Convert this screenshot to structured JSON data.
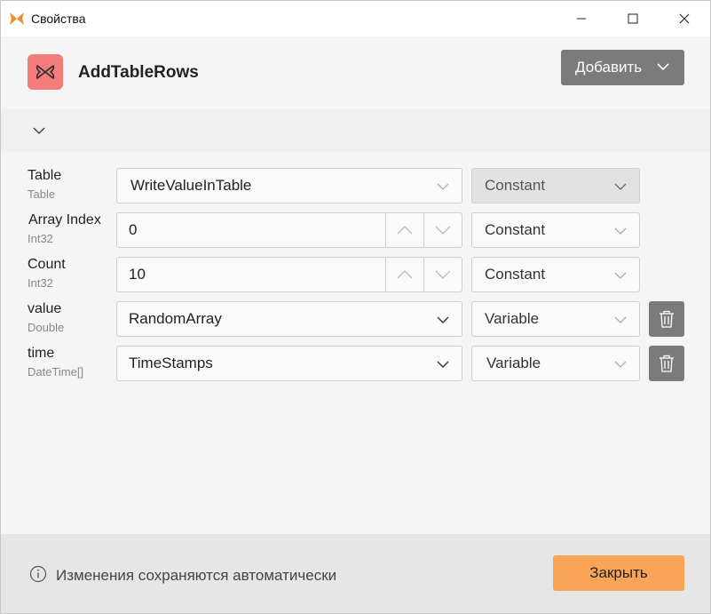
{
  "window": {
    "title": "Свойства"
  },
  "header": {
    "node_title": "AddTableRows",
    "add_button_label": "Добавить"
  },
  "properties": [
    {
      "name": "Table",
      "type": "Table",
      "value": "WriteValueInTable",
      "mode": "Constant",
      "kind": "dropdown",
      "mode_disabled": true,
      "deletable": false
    },
    {
      "name": "Array Index",
      "type": "Int32",
      "value": "0",
      "mode": "Constant",
      "kind": "number",
      "mode_disabled": false,
      "deletable": false
    },
    {
      "name": "Count",
      "type": "Int32",
      "value": "10",
      "mode": "Constant",
      "kind": "number",
      "mode_disabled": false,
      "deletable": false
    },
    {
      "name": "value",
      "type": "Double",
      "value": "RandomArray",
      "mode": "Variable",
      "kind": "dropdown",
      "mode_disabled": false,
      "deletable": true
    },
    {
      "name": "time",
      "type": "DateTime[]",
      "value": "TimeStamps",
      "mode": "Variable",
      "kind": "dropdown",
      "mode_disabled": false,
      "deletable": true
    }
  ],
  "footer": {
    "info_text": "Изменения сохраняются автоматически",
    "close_label": "Закрыть"
  },
  "colors": {
    "accent_orange": "#f9a457",
    "node_icon_bg": "#f47c7c",
    "button_gray": "#7b7b7b"
  },
  "icons": {
    "app": "butterfly-icon",
    "node": "butterfly-icon",
    "delete": "trash-icon",
    "info": "info-icon"
  }
}
